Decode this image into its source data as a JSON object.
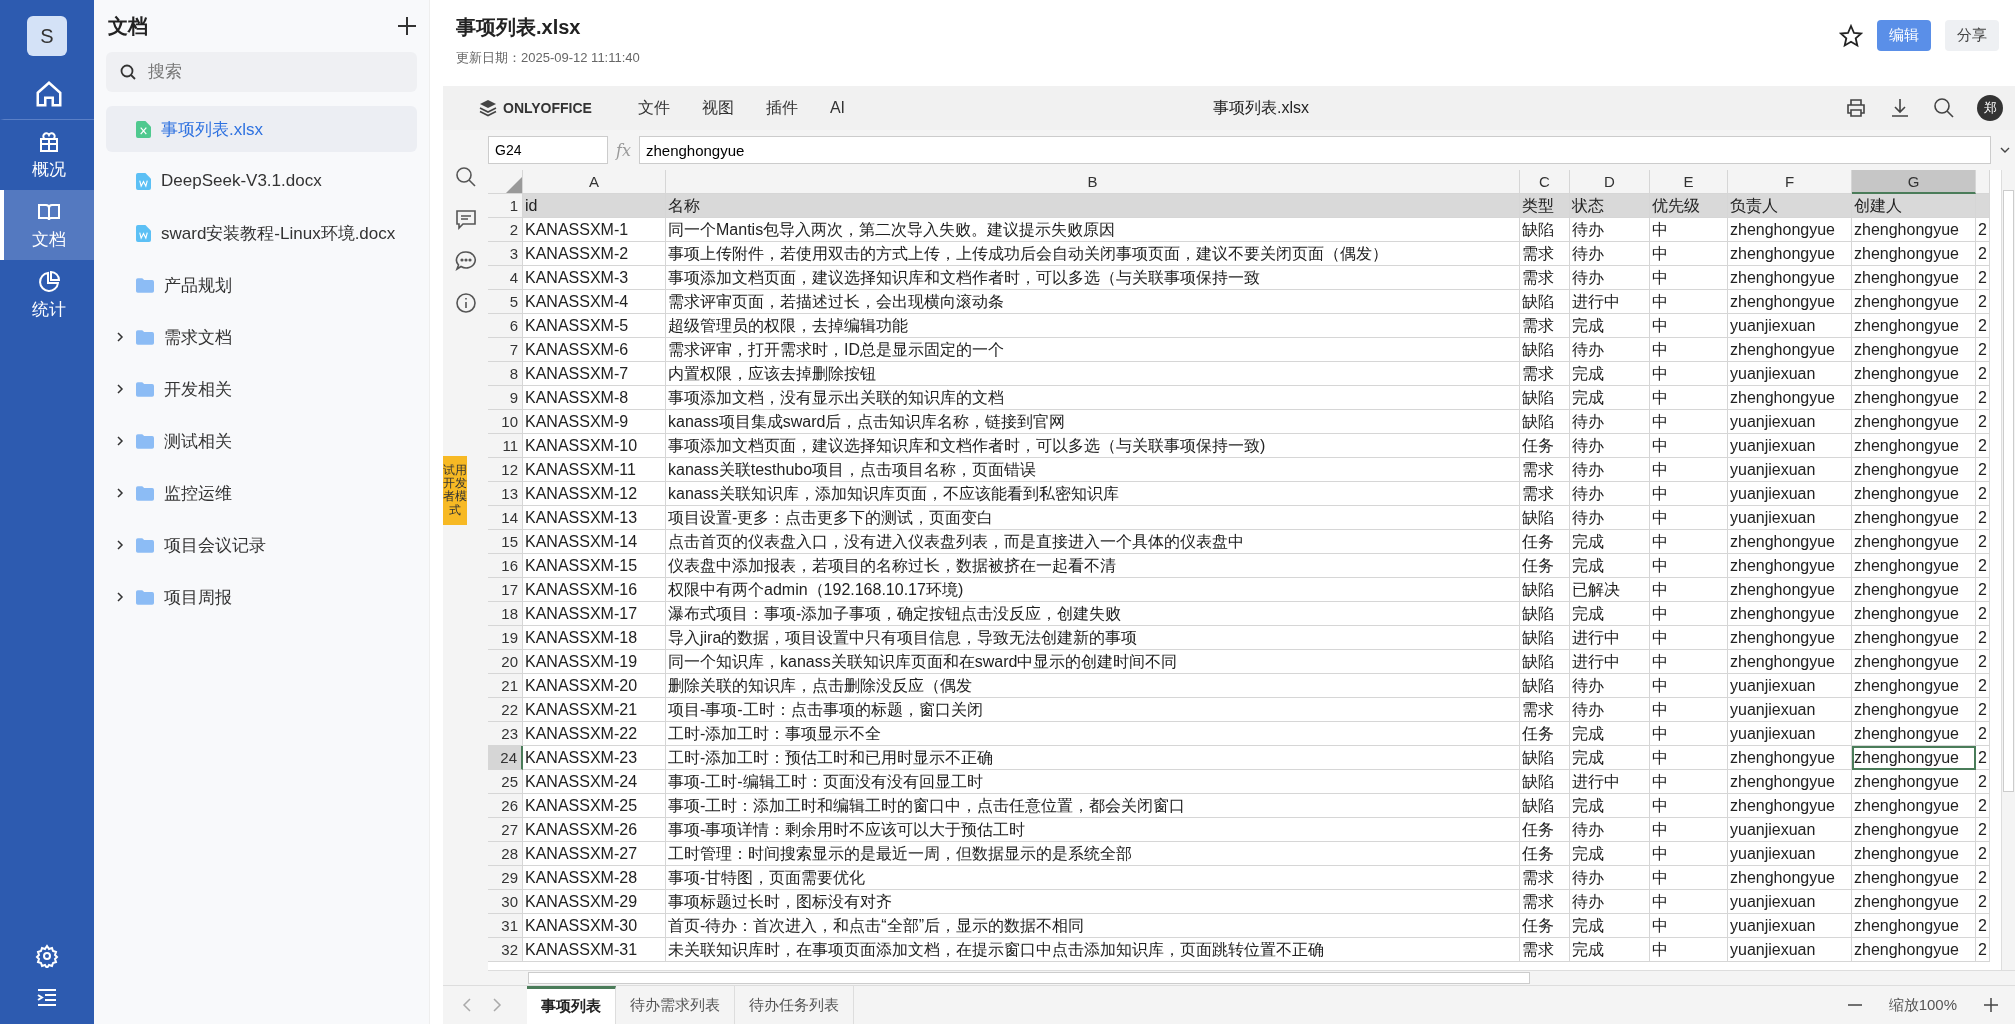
{
  "nav": {
    "avatar": "S",
    "items": [
      {
        "kind": "home",
        "selected": false
      },
      {
        "kind": "overview",
        "label": "概况",
        "selected": false
      },
      {
        "kind": "docs",
        "label": "文档",
        "selected": true
      },
      {
        "kind": "stats",
        "label": "统计",
        "selected": false
      }
    ]
  },
  "sidebar": {
    "title": "文档",
    "search": {
      "placeholder": "搜索"
    },
    "items": [
      {
        "kind": "xlsx",
        "label": "事项列表.xlsx",
        "selected": true
      },
      {
        "kind": "docx",
        "label": "DeepSeek-V3.1.docx",
        "selected": false
      },
      {
        "kind": "docx",
        "label": "sward安装教程-Linux环境.docx",
        "selected": false
      },
      {
        "kind": "folder",
        "label": "产品规划",
        "selected": false
      },
      {
        "kind": "folder",
        "label": "需求文档",
        "selected": false,
        "expanded": false
      },
      {
        "kind": "folder",
        "label": "开发相关",
        "selected": false,
        "expanded": false
      },
      {
        "kind": "folder",
        "label": "测试相关",
        "selected": false,
        "expanded": false
      },
      {
        "kind": "folder",
        "label": "监控运维",
        "selected": false,
        "expanded": false
      },
      {
        "kind": "folder",
        "label": "项目会议记录",
        "selected": false,
        "expanded": false
      },
      {
        "kind": "folder",
        "label": "项目周报",
        "selected": false,
        "expanded": false
      }
    ]
  },
  "header": {
    "title": "事项列表.xlsx",
    "updated": "更新日期：2025-09-12 11:11:40",
    "buttons": [
      {
        "label": "编辑",
        "kind": "primary"
      },
      {
        "label": "分享",
        "kind": "secondary"
      }
    ]
  },
  "editor": {
    "brand": "ONLYOFFICE",
    "menus": [
      "文件",
      "视图",
      "插件",
      "AI"
    ],
    "title": "事项列表.xlsx",
    "user": "郑",
    "formula": {
      "cell": "G24",
      "fx": "fx",
      "value": "zhenghongyue"
    },
    "side_tab": "试用开发者模式",
    "columns": [
      {
        "label": "A",
        "selected": false
      },
      {
        "label": "B",
        "selected": false
      },
      {
        "label": "C",
        "selected": false
      },
      {
        "label": "D",
        "selected": false
      },
      {
        "label": "E",
        "selected": false
      },
      {
        "label": "F",
        "selected": false
      },
      {
        "label": "G",
        "selected": true
      }
    ],
    "rows": [
      {
        "n": "1",
        "selected": false,
        "cells": [
          "id",
          "名称",
          "类型",
          "状态",
          "优先级",
          "负责人",
          "创建人"
        ]
      },
      {
        "n": "2",
        "selected": false,
        "cells": [
          "KANASSXM-1",
          "同一个Mantis包导入两次，第二次导入失败。建议提示失败原因",
          "缺陷",
          "待办",
          "中",
          "zhenghongyue",
          "zhenghongyue",
          "2"
        ]
      },
      {
        "n": "3",
        "selected": false,
        "cells": [
          "KANASSXM-2",
          "事项上传附件，若使用双击的方式上传，上传成功后会自动关闭事项页面，建议不要关闭页面（偶发）",
          "需求",
          "待办",
          "中",
          "zhenghongyue",
          "zhenghongyue",
          "2"
        ]
      },
      {
        "n": "4",
        "selected": false,
        "cells": [
          "KANASSXM-3",
          "事项添加文档页面，建议选择知识库和文档作者时，可以多选（与关联事项保持一致",
          "需求",
          "待办",
          "中",
          "zhenghongyue",
          "zhenghongyue",
          "2"
        ]
      },
      {
        "n": "5",
        "selected": false,
        "cells": [
          "KANASSXM-4",
          "需求评审页面，若描述过长，会出现横向滚动条",
          "缺陷",
          "进行中",
          "中",
          "zhenghongyue",
          "zhenghongyue",
          "2"
        ]
      },
      {
        "n": "6",
        "selected": false,
        "cells": [
          "KANASSXM-5",
          "超级管理员的权限，去掉编辑功能",
          "需求",
          "完成",
          "中",
          "yuanjiexuan",
          "zhenghongyue",
          "2"
        ]
      },
      {
        "n": "7",
        "selected": false,
        "cells": [
          "KANASSXM-6",
          "需求评审，打开需求时，ID总是显示固定的一个",
          "缺陷",
          "待办",
          "中",
          "zhenghongyue",
          "zhenghongyue",
          "2"
        ]
      },
      {
        "n": "8",
        "selected": false,
        "cells": [
          "KANASSXM-7",
          "内置权限，应该去掉删除按钮",
          "需求",
          "完成",
          "中",
          "yuanjiexuan",
          "zhenghongyue",
          "2"
        ]
      },
      {
        "n": "9",
        "selected": false,
        "cells": [
          "KANASSXM-8",
          "事项添加文档，没有显示出关联的知识库的文档",
          "缺陷",
          "完成",
          "中",
          "zhenghongyue",
          "zhenghongyue",
          "2"
        ]
      },
      {
        "n": "10",
        "selected": false,
        "cells": [
          "KANASSXM-9",
          "kanass项目集成sward后，点击知识库名称，链接到官网",
          "缺陷",
          "待办",
          "中",
          "yuanjiexuan",
          "zhenghongyue",
          "2"
        ]
      },
      {
        "n": "11",
        "selected": false,
        "cells": [
          "KANASSXM-10",
          "事项添加文档页面，建议选择知识库和文档作者时，可以多选（与关联事项保持一致)",
          "任务",
          "待办",
          "中",
          "yuanjiexuan",
          "zhenghongyue",
          "2"
        ]
      },
      {
        "n": "12",
        "selected": false,
        "cells": [
          "KANASSXM-11",
          "kanass关联testhubo项目，点击项目名称，页面错误",
          "需求",
          "待办",
          "中",
          "yuanjiexuan",
          "zhenghongyue",
          "2"
        ]
      },
      {
        "n": "13",
        "selected": false,
        "cells": [
          "KANASSXM-12",
          "kanass关联知识库，添加知识库页面，不应该能看到私密知识库",
          "需求",
          "待办",
          "中",
          "yuanjiexuan",
          "zhenghongyue",
          "2"
        ]
      },
      {
        "n": "14",
        "selected": false,
        "cells": [
          "KANASSXM-13",
          "项目设置-更多：点击更多下的测试，页面变白",
          "缺陷",
          "待办",
          "中",
          "yuanjiexuan",
          "zhenghongyue",
          "2"
        ]
      },
      {
        "n": "15",
        "selected": false,
        "cells": [
          "KANASSXM-14",
          "点击首页的仪表盘入口，没有进入仪表盘列表，而是直接进入一个具体的仪表盘中",
          "任务",
          "完成",
          "中",
          "zhenghongyue",
          "zhenghongyue",
          "2"
        ]
      },
      {
        "n": "16",
        "selected": false,
        "cells": [
          "KANASSXM-15",
          "仪表盘中添加报表，若项目的名称过长，数据被挤在一起看不清",
          "任务",
          "完成",
          "中",
          "zhenghongyue",
          "zhenghongyue",
          "2"
        ]
      },
      {
        "n": "17",
        "selected": false,
        "cells": [
          "KANASSXM-16",
          "权限中有两个admin（192.168.10.17环境)",
          "缺陷",
          "已解决",
          "中",
          "zhenghongyue",
          "zhenghongyue",
          "2"
        ]
      },
      {
        "n": "18",
        "selected": false,
        "cells": [
          "KANASSXM-17",
          "瀑布式项目：事项-添加子事项，确定按钮点击没反应，创建失败",
          "缺陷",
          "完成",
          "中",
          "zhenghongyue",
          "zhenghongyue",
          "2"
        ]
      },
      {
        "n": "19",
        "selected": false,
        "cells": [
          "KANASSXM-18",
          "导入jira的数据，项目设置中只有项目信息，导致无法创建新的事项",
          "缺陷",
          "进行中",
          "中",
          "zhenghongyue",
          "zhenghongyue",
          "2"
        ]
      },
      {
        "n": "20",
        "selected": false,
        "cells": [
          "KANASSXM-19",
          "同一个知识库，kanass关联知识库页面和在sward中显示的创建时间不同",
          "缺陷",
          "进行中",
          "中",
          "zhenghongyue",
          "zhenghongyue",
          "2"
        ]
      },
      {
        "n": "21",
        "selected": false,
        "cells": [
          "KANASSXM-20",
          "删除关联的知识库，点击删除没反应（偶发",
          "缺陷",
          "待办",
          "中",
          "yuanjiexuan",
          "zhenghongyue",
          "2"
        ]
      },
      {
        "n": "22",
        "selected": false,
        "cells": [
          "KANASSXM-21",
          "项目-事项-工时：点击事项的标题，窗口关闭",
          "需求",
          "待办",
          "中",
          "yuanjiexuan",
          "zhenghongyue",
          "2"
        ]
      },
      {
        "n": "23",
        "selected": false,
        "cells": [
          "KANASSXM-22",
          "工时-添加工时：事项显示不全",
          "任务",
          "完成",
          "中",
          "yuanjiexuan",
          "zhenghongyue",
          "2"
        ]
      },
      {
        "n": "24",
        "selected": true,
        "cells": [
          "KANASSXM-23",
          "工时-添加工时：预估工时和已用时显示不正确",
          "缺陷",
          "完成",
          "中",
          "zhenghongyue",
          "zhenghongyue",
          "2"
        ]
      },
      {
        "n": "25",
        "selected": false,
        "cells": [
          "KANASSXM-24",
          "事项-工时-编辑工时：页面没有没有回显工时",
          "缺陷",
          "进行中",
          "中",
          "zhenghongyue",
          "zhenghongyue",
          "2"
        ]
      },
      {
        "n": "26",
        "selected": false,
        "cells": [
          "KANASSXM-25",
          "事项-工时：添加工时和编辑工时的窗口中，点击任意位置，都会关闭窗口",
          "缺陷",
          "完成",
          "中",
          "zhenghongyue",
          "zhenghongyue",
          "2"
        ]
      },
      {
        "n": "27",
        "selected": false,
        "cells": [
          "KANASSXM-26",
          "事项-事项详情：剩余用时不应该可以大于预估工时",
          "任务",
          "待办",
          "中",
          "yuanjiexuan",
          "zhenghongyue",
          "2"
        ]
      },
      {
        "n": "28",
        "selected": false,
        "cells": [
          "KANASSXM-27",
          "工时管理：时间搜索显示的是最近一周，但数据显示的是系统全部",
          "任务",
          "完成",
          "中",
          "yuanjiexuan",
          "zhenghongyue",
          "2"
        ]
      },
      {
        "n": "29",
        "selected": false,
        "cells": [
          "KANASSXM-28",
          "事项-甘特图，页面需要优化",
          "需求",
          "待办",
          "中",
          "zhenghongyue",
          "zhenghongyue",
          "2"
        ]
      },
      {
        "n": "30",
        "selected": false,
        "cells": [
          "KANASSXM-29",
          "事项标题过长时，图标没有对齐",
          "需求",
          "待办",
          "中",
          "yuanjiexuan",
          "zhenghongyue",
          "2"
        ]
      },
      {
        "n": "31",
        "selected": false,
        "cells": [
          "KANASSXM-30",
          "首页-待办：首次进入，和点击“全部”后，显示的数据不相同",
          "任务",
          "完成",
          "中",
          "yuanjiexuan",
          "zhenghongyue",
          "2"
        ]
      },
      {
        "n": "32",
        "selected": false,
        "cells": [
          "KANASSXM-31",
          "未关联知识库时，在事项页面添加文档，在提示窗口中点击添加知识库，页面跳转位置不正确",
          "需求",
          "完成",
          "中",
          "yuanjiexuan",
          "zhenghongyue",
          "2"
        ]
      }
    ],
    "sheets": [
      {
        "label": "事项列表",
        "selected": true
      },
      {
        "label": "待办需求列表",
        "selected": false
      },
      {
        "label": "待办任务列表",
        "selected": false
      }
    ],
    "zoom": "缩放100%"
  }
}
